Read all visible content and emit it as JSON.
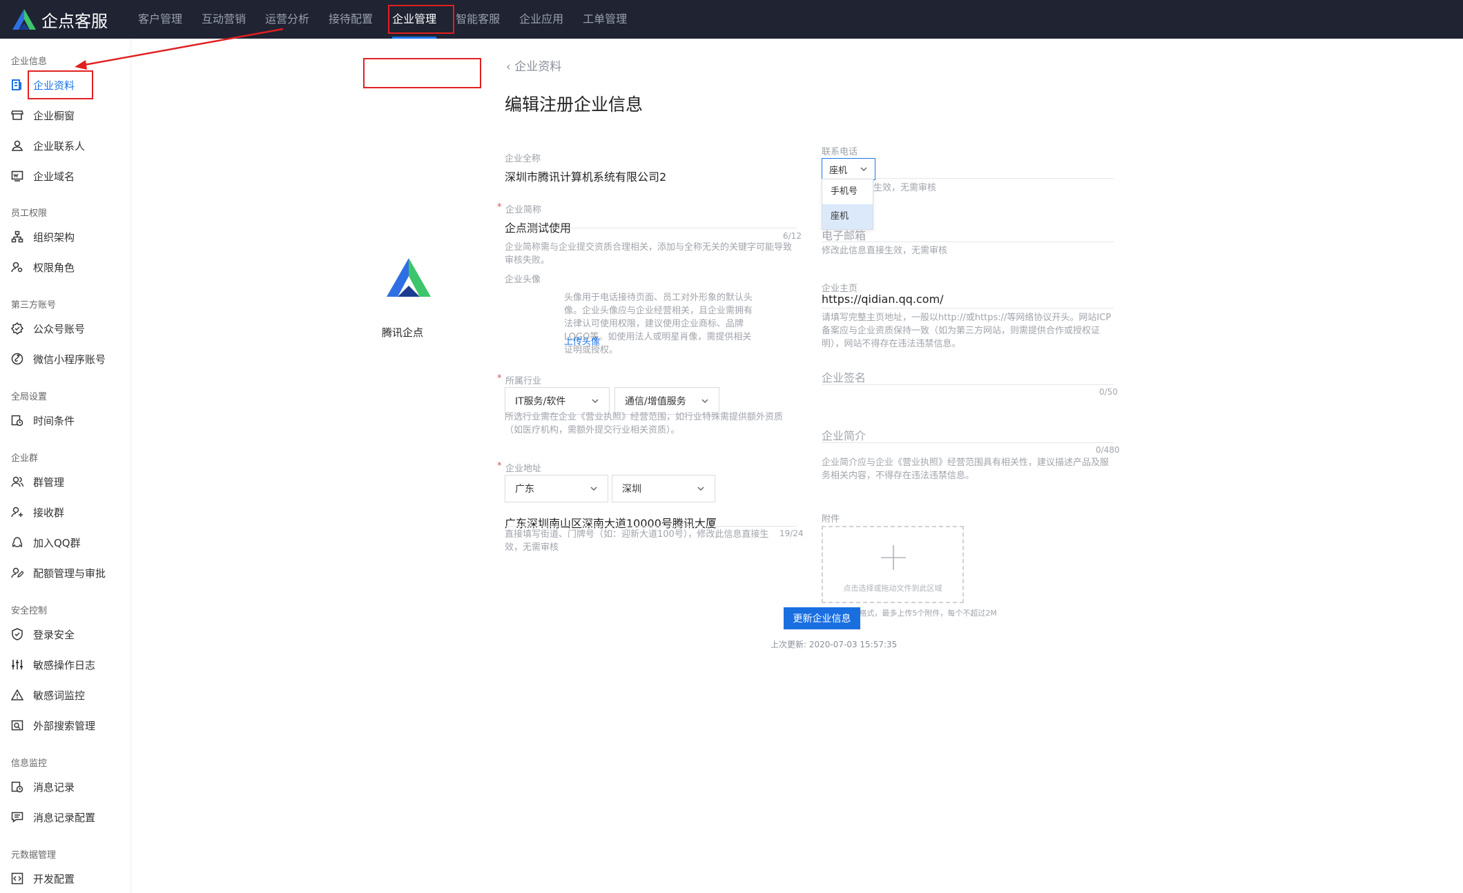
{
  "app": {
    "name": "企点客服"
  },
  "nav": [
    "客户管理",
    "互动营销",
    "运营分析",
    "接待配置",
    "企业管理",
    "智能客服",
    "企业应用",
    "工单管理"
  ],
  "sidebar": {
    "groups": [
      {
        "title": "企业信息",
        "items": [
          {
            "label": "企业资料",
            "icon": "document-icon",
            "active": true
          },
          {
            "label": "企业橱窗",
            "icon": "storefront-icon"
          },
          {
            "label": "企业联系人",
            "icon": "contact-icon"
          },
          {
            "label": "企业域名",
            "icon": "domain-icon"
          }
        ]
      },
      {
        "title": "员工权限",
        "items": [
          {
            "label": "组织架构",
            "icon": "org-chart-icon"
          },
          {
            "label": "权限角色",
            "icon": "role-icon"
          }
        ]
      },
      {
        "title": "第三方账号",
        "items": [
          {
            "label": "公众号账号",
            "icon": "official-account-icon"
          },
          {
            "label": "微信小程序账号",
            "icon": "mini-program-icon"
          }
        ]
      },
      {
        "title": "全局设置",
        "items": [
          {
            "label": "时间条件",
            "icon": "time-icon"
          }
        ]
      },
      {
        "title": "企业群",
        "items": [
          {
            "label": "群管理",
            "icon": "group-icon"
          },
          {
            "label": "接收群",
            "icon": "receive-group-icon"
          },
          {
            "label": "加入QQ群",
            "icon": "qq-group-icon"
          },
          {
            "label": "配额管理与审批",
            "icon": "quota-icon"
          }
        ]
      },
      {
        "title": "安全控制",
        "items": [
          {
            "label": "登录安全",
            "icon": "shield-icon"
          },
          {
            "label": "敏感操作日志",
            "icon": "sliders-icon"
          },
          {
            "label": "敏感词监控",
            "icon": "warning-icon"
          },
          {
            "label": "外部搜索管理",
            "icon": "search-box-icon"
          }
        ]
      },
      {
        "title": "信息监控",
        "items": [
          {
            "label": "消息记录",
            "icon": "message-record-icon"
          },
          {
            "label": "消息记录配置",
            "icon": "message-config-icon"
          }
        ]
      },
      {
        "title": "元数据管理",
        "items": [
          {
            "label": "开发配置",
            "icon": "code-icon"
          }
        ]
      }
    ]
  },
  "page": {
    "back_label": "企业资料",
    "title": "编辑注册企业信息",
    "left": {
      "full_name": {
        "label": "企业全称",
        "value": "深圳市腾讯计算机系统有限公司2"
      },
      "short_name": {
        "required": "*",
        "label": "企业简称",
        "value": "企点测试使用",
        "counter": "6/12",
        "hint": "企业简称需与企业提交资质合理相关，添加与全称无关的关键字可能导致审核失败。"
      },
      "avatar": {
        "label": "企业头像",
        "logo_text": "腾讯企点",
        "hint": "头像用于电话接待页面、员工对外形象的默认头像。企业头像应与企业经营相关，且企业需拥有法律认可使用权限，建议使用企业商标、品牌LOGO等。如使用法人或明星肖像，需提供相关证明或授权。",
        "upload": "上传头像"
      },
      "industry": {
        "required": "*",
        "label": "所属行业",
        "primary": "IT服务/软件",
        "secondary": "通信/增值服务",
        "hint": "所选行业需在企业《营业执照》经营范围，如行业特殊需提供额外资质（如医疗机构，需额外提交行业相关资质）。"
      },
      "address": {
        "required": "*",
        "label": "企业地址",
        "province": "广东",
        "city": "深圳",
        "detail": "广东深圳南山区深南大道10000号腾讯大厦",
        "hint": "直接填写街道、门牌号（如：迎新大道100号），修改此信息直接生效，无需审核",
        "counter": "19/24"
      }
    },
    "right": {
      "phone": {
        "label": "联系电话",
        "type_selected": "座机",
        "options": [
          "手机号",
          "座机"
        ],
        "hint_partial": "生效，无需审核"
      },
      "email": {
        "label": "电子邮箱",
        "hint": "修改此信息直接生效，无需审核"
      },
      "homepage": {
        "label": "企业主页",
        "value": "https://qidian.qq.com/",
        "hint": "请填写完整主页地址，一般以http://或https://等网络协议开头。网站ICP备案应与企业资质保持一致（如为第三方网站，则需提供合作或授权证明），网站不得存在违法违禁信息。"
      },
      "signature": {
        "label": "企业签名",
        "counter": "0/50"
      },
      "intro": {
        "label": "企业简介",
        "counter": "0/480",
        "hint": "企业简介应与企业《营业执照》经营范围具有相关性，建议描述产品及服务相关内容，不得存在违法违禁信息。"
      },
      "attachment": {
        "label": "附件",
        "dropzone": "点击选择或拖动文件到此区域",
        "hint": "图片或PDF格式，最多上传5个附件，每个不超过2M"
      }
    },
    "submit_label": "更新企业信息",
    "last_update": "上次更新: 2020-07-03 15:57:35"
  },
  "colors": {
    "topbar": "#1f2332",
    "accent": "#1a73e8",
    "highlight": "#e02020"
  }
}
